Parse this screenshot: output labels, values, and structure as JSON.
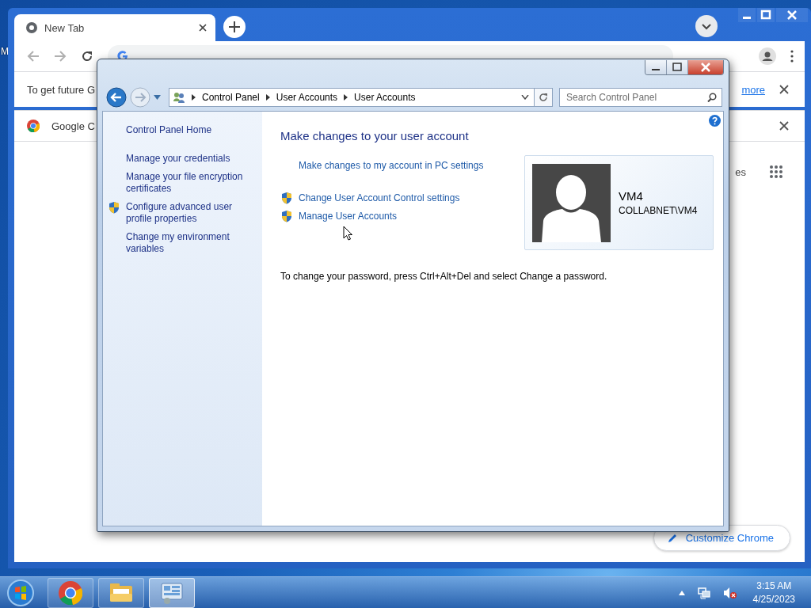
{
  "desktop": {
    "icon_label": "M"
  },
  "chrome": {
    "tabs": [
      {
        "label": "New Tab",
        "selected": true
      }
    ],
    "infobar": {
      "text": "To get future G",
      "link": "more"
    },
    "promo_bar": {
      "text": "Google C"
    },
    "shortcut_label": "es",
    "customize_button": "Customize Chrome"
  },
  "control_panel": {
    "breadcrumb": [
      "Control Panel",
      "User Accounts",
      "User Accounts"
    ],
    "search": {
      "placeholder": "Search Control Panel"
    },
    "sidebar": {
      "home": "Control Panel Home",
      "links": [
        {
          "label": "Manage your credentials",
          "shield": false
        },
        {
          "label": "Manage your file encryption certificates",
          "shield": false
        },
        {
          "label": "Configure advanced user profile properties",
          "shield": true
        },
        {
          "label": "Change my environment variables",
          "shield": false
        }
      ]
    },
    "heading": "Make changes to your user account",
    "tasks": [
      {
        "label": "Make changes to my account in PC settings",
        "shield": false
      },
      {
        "label": "Change User Account Control settings",
        "shield": true
      },
      {
        "label": "Manage User Accounts",
        "shield": true
      }
    ],
    "account": {
      "name": "VM4",
      "domain": "COLLABNET\\VM4"
    },
    "note": "To change your password, press Ctrl+Alt+Del and select Change a password."
  },
  "taskbar": {
    "apps": [
      {
        "kind": "chrome",
        "selected": false
      },
      {
        "kind": "explorer",
        "selected": false
      },
      {
        "kind": "control-panel",
        "selected": true
      }
    ],
    "time": "3:15 AM",
    "date": "4/25/2023"
  }
}
